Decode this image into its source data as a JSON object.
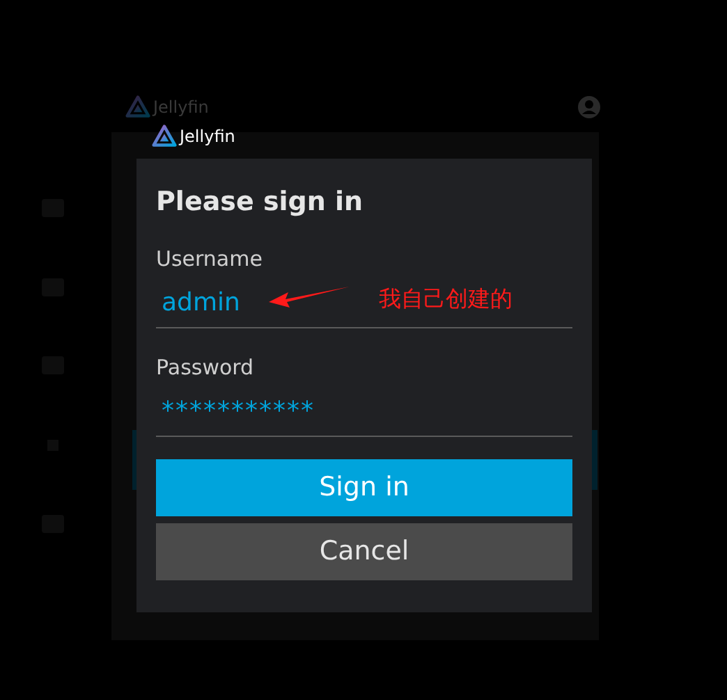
{
  "app_bar": {
    "title": "Jellyfin"
  },
  "server": {
    "title": "Jellyfin"
  },
  "dialog": {
    "title": "Please sign in",
    "fields": [
      {
        "label": "Username",
        "value": "admin",
        "kind": "text"
      },
      {
        "label": "Password",
        "value": "***********",
        "kind": "password"
      }
    ],
    "buttons": [
      {
        "label": "Sign in",
        "kind": "primary"
      },
      {
        "label": "Cancel",
        "kind": "secondary"
      }
    ]
  },
  "annotation": {
    "text": "我自己创建的"
  }
}
